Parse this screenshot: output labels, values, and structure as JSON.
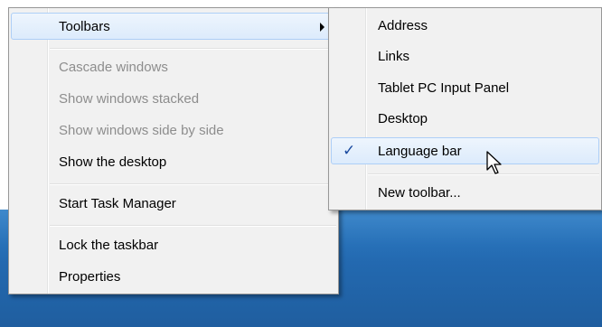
{
  "context_menu": {
    "items": [
      {
        "label": "Toolbars",
        "has_submenu": true,
        "state": "highlighted"
      },
      {
        "label": "Cascade windows",
        "state": "disabled"
      },
      {
        "label": "Show windows stacked",
        "state": "disabled"
      },
      {
        "label": "Show windows side by side",
        "state": "disabled"
      },
      {
        "label": "Show the desktop",
        "state": "enabled"
      },
      {
        "label": "Start Task Manager",
        "state": "enabled"
      },
      {
        "label": "Lock the taskbar",
        "state": "enabled"
      },
      {
        "label": "Properties",
        "state": "enabled"
      }
    ]
  },
  "toolbars_submenu": {
    "items": [
      {
        "label": "Address",
        "checked": false
      },
      {
        "label": "Links",
        "checked": false
      },
      {
        "label": "Tablet PC Input Panel",
        "checked": false
      },
      {
        "label": "Desktop",
        "checked": false
      },
      {
        "label": "Language bar",
        "checked": true,
        "state": "hovered"
      },
      {
        "label": "New toolbar...",
        "checked": false
      }
    ],
    "check_glyph": "✓"
  },
  "colors": {
    "menu_background": "#f1f1f1",
    "highlight_border": "#aecff7",
    "disabled_text": "#8d8d8d",
    "checkmark": "#1a4a9f",
    "desktop_blue": "#2369b0"
  },
  "icons": {
    "submenu_arrow": "chevron-right-icon",
    "checkmark": "checkmark-icon",
    "pointer": "mouse-pointer-icon"
  }
}
